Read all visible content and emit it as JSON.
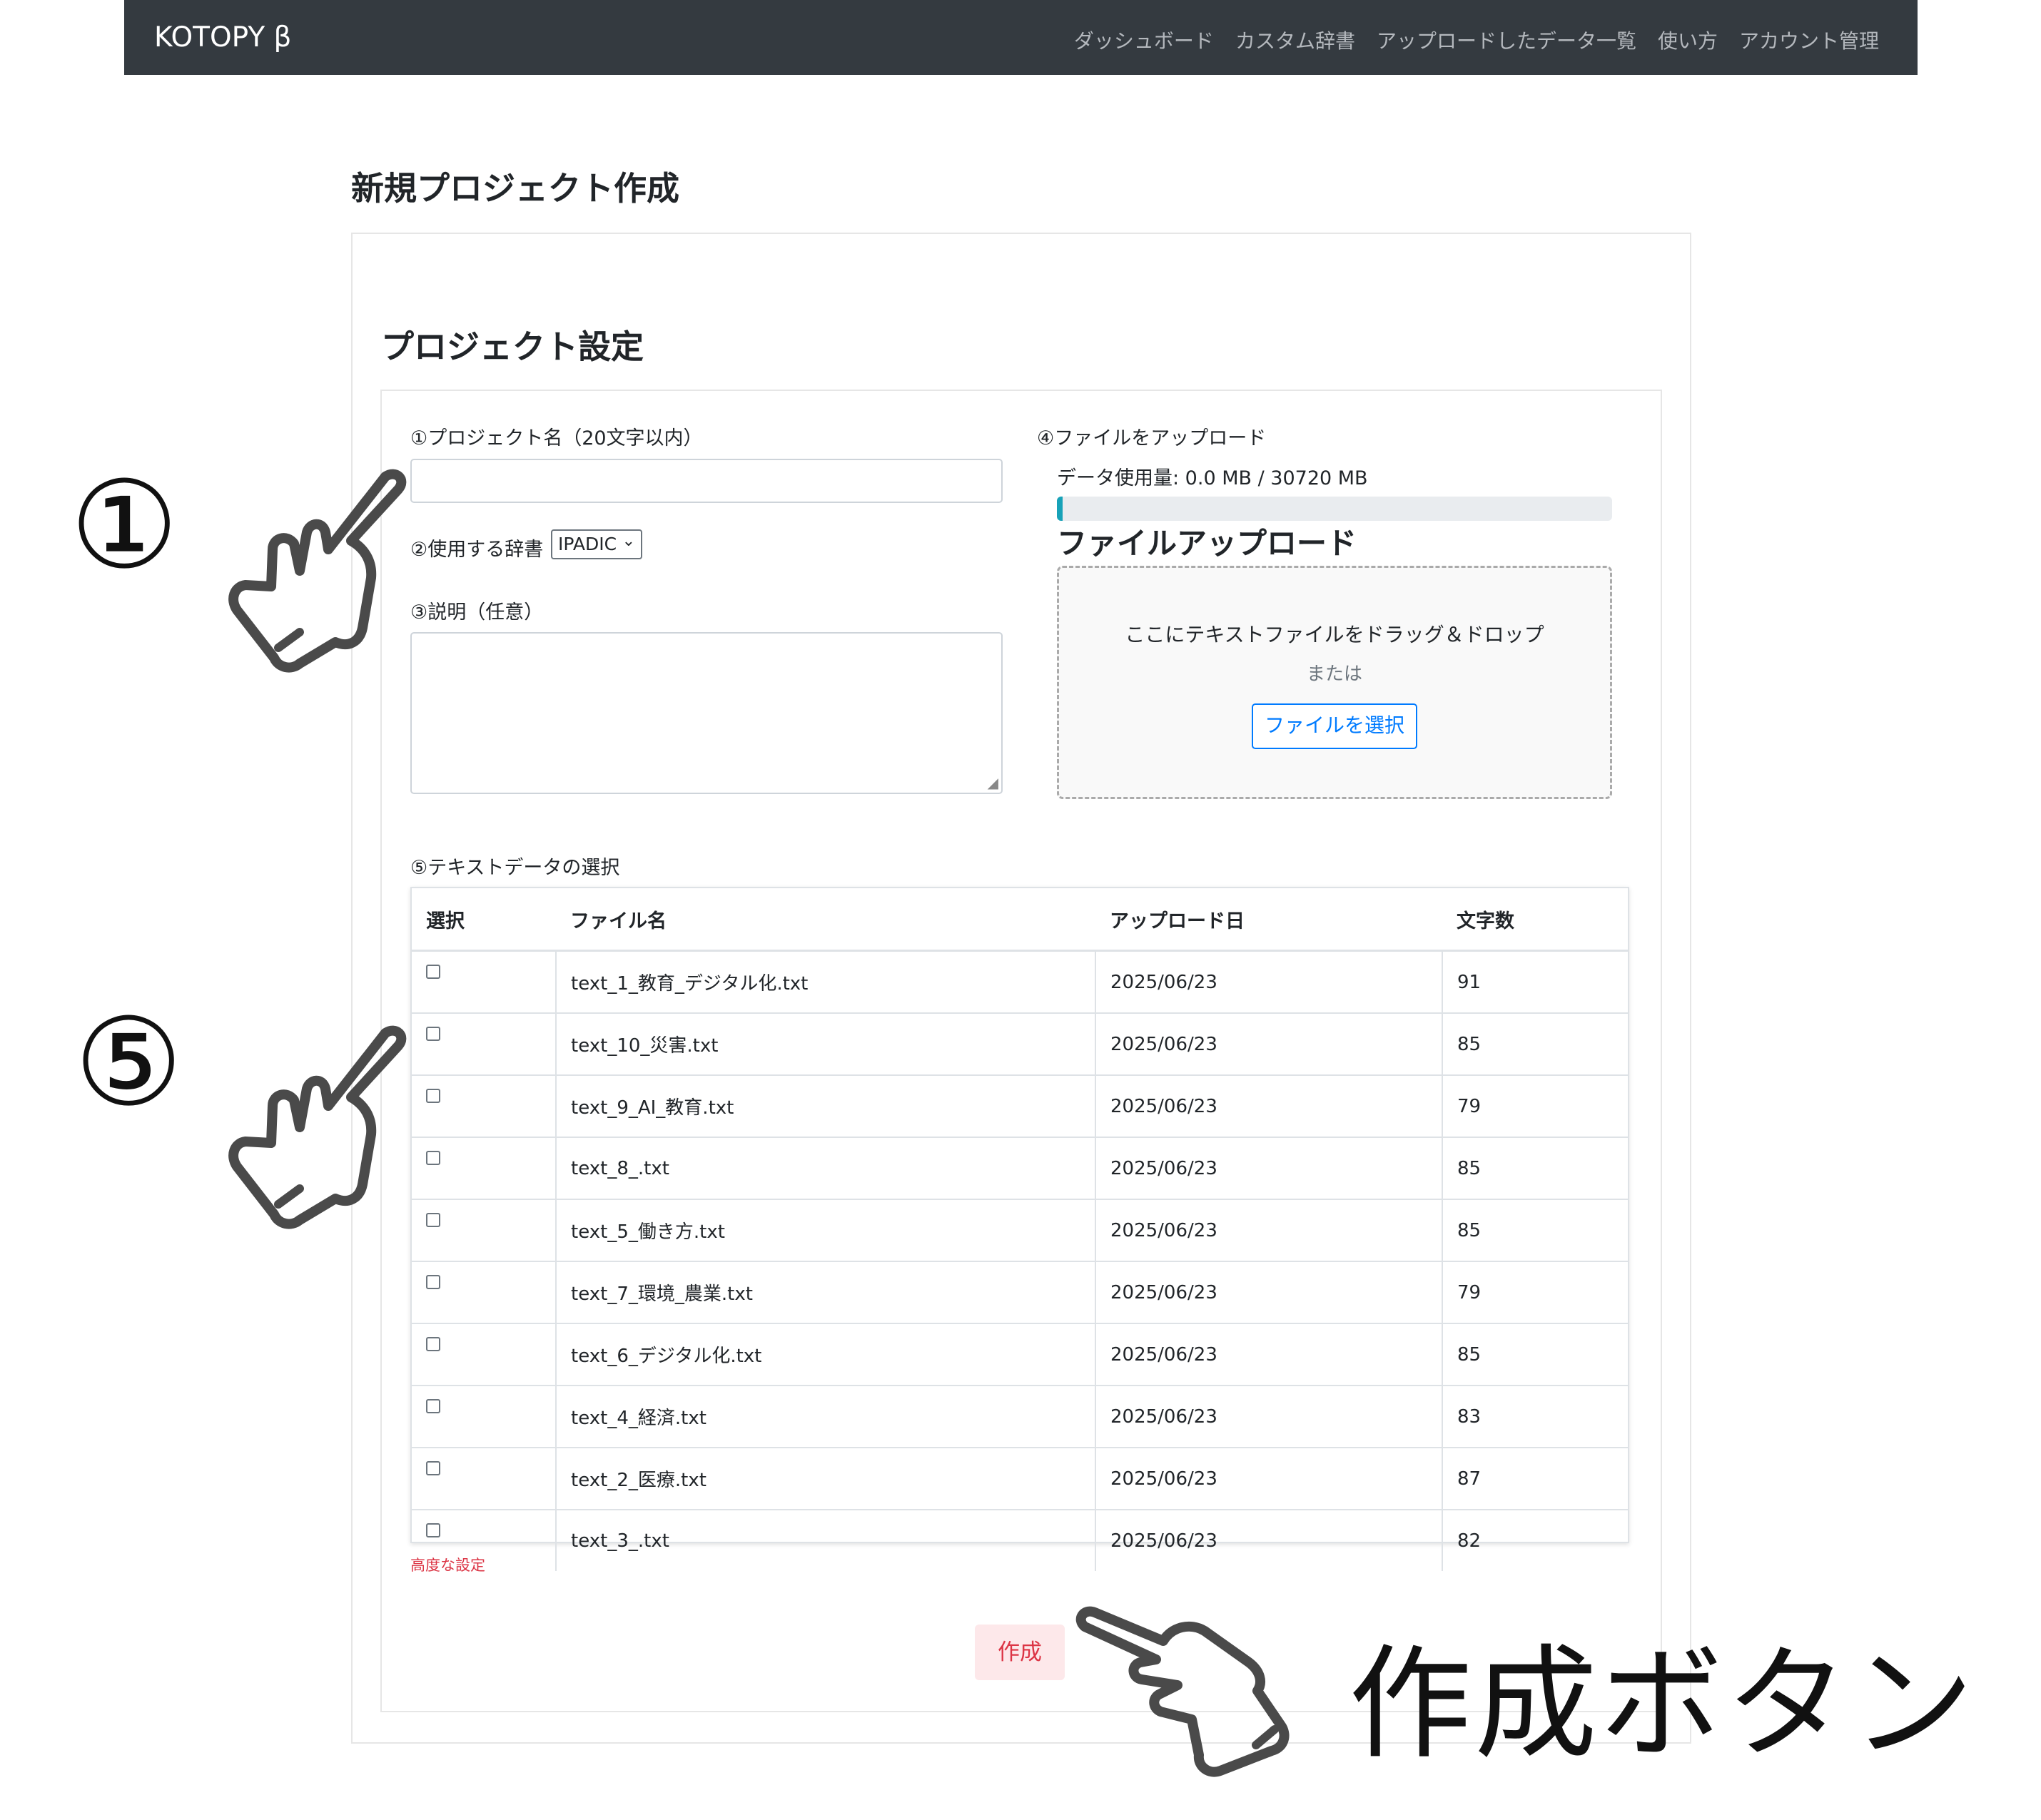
{
  "navbar": {
    "brand": "KOTOPY β",
    "links": [
      "ダッシュボード",
      "カスタム辞書",
      "アップロードしたデータ一覧",
      "使い方",
      "アカウント管理"
    ]
  },
  "page_title": "新規プロジェクト作成",
  "section_title": "プロジェクト設定",
  "form": {
    "name_label": "①プロジェクト名（20文字以内）",
    "name_value": "",
    "dict_label": "②使用する辞書",
    "dict_selected": "IPADIC",
    "desc_label": "③説明（任意）",
    "desc_value": ""
  },
  "upload": {
    "label": "④ファイルをアップロード",
    "usage_text": "データ使用量: 0.0 MB / 30720 MB",
    "usage_fraction": 0.01,
    "title": "ファイルアップロード",
    "drop_text": "ここにテキストファイルをドラッグ＆ドロップ",
    "or_text": "または",
    "select_button": "ファイルを選択"
  },
  "text_select": {
    "label": "⑤テキストデータの選択",
    "columns": [
      "選択",
      "ファイル名",
      "アップロード日",
      "文字数"
    ],
    "rows": [
      {
        "file": "text_1_教育_デジタル化.txt",
        "date": "2025/06/23",
        "chars": "91"
      },
      {
        "file": "text_10_災害.txt",
        "date": "2025/06/23",
        "chars": "85"
      },
      {
        "file": "text_9_AI_教育.txt",
        "date": "2025/06/23",
        "chars": "79"
      },
      {
        "file": "text_8_.txt",
        "date": "2025/06/23",
        "chars": "85"
      },
      {
        "file": "text_5_働き方.txt",
        "date": "2025/06/23",
        "chars": "85"
      },
      {
        "file": "text_7_環境_農業.txt",
        "date": "2025/06/23",
        "chars": "79"
      },
      {
        "file": "text_6_デジタル化.txt",
        "date": "2025/06/23",
        "chars": "85"
      },
      {
        "file": "text_4_経済.txt",
        "date": "2025/06/23",
        "chars": "83"
      },
      {
        "file": "text_2_医療.txt",
        "date": "2025/06/23",
        "chars": "87"
      },
      {
        "file": "text_3_.txt",
        "date": "2025/06/23",
        "chars": "82"
      }
    ]
  },
  "advanced_link": "高度な設定",
  "create_button": "作成",
  "annotations": {
    "marker_1": "①",
    "marker_5": "⑤",
    "create_label": "作成ボタン",
    "hand_icon": "pointing-hand-icon"
  },
  "colors": {
    "navbar_bg": "#343a40",
    "primary": "#007bff",
    "danger": "#dc3545",
    "progress": "#17a2b8"
  }
}
